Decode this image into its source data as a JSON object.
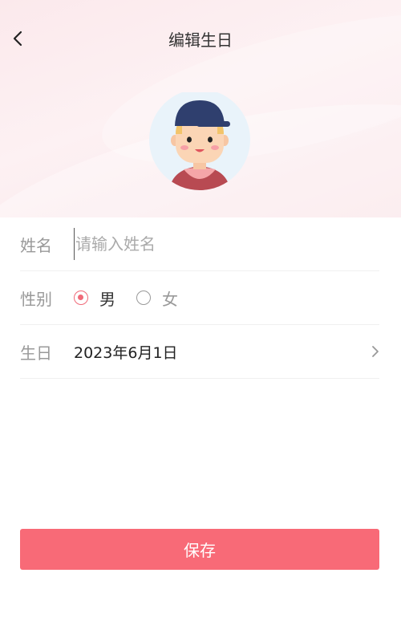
{
  "header": {
    "title": "编辑生日",
    "back_icon": "chevron-left-icon",
    "avatar_icon": "boy-cap-avatar-icon"
  },
  "form": {
    "name": {
      "label": "姓名",
      "value": "",
      "placeholder": "请输入姓名"
    },
    "gender": {
      "label": "性别",
      "options": [
        {
          "label": "男",
          "checked": true
        },
        {
          "label": "女",
          "checked": false
        }
      ]
    },
    "birthday": {
      "label": "生日",
      "value": "2023年6月1日",
      "chevron_icon": "chevron-right-icon"
    }
  },
  "footer": {
    "save_label": "保存"
  },
  "colors": {
    "accent": "#f86a77",
    "radio_checked": "#f06a78",
    "header_bg": "#fbe9ec"
  }
}
